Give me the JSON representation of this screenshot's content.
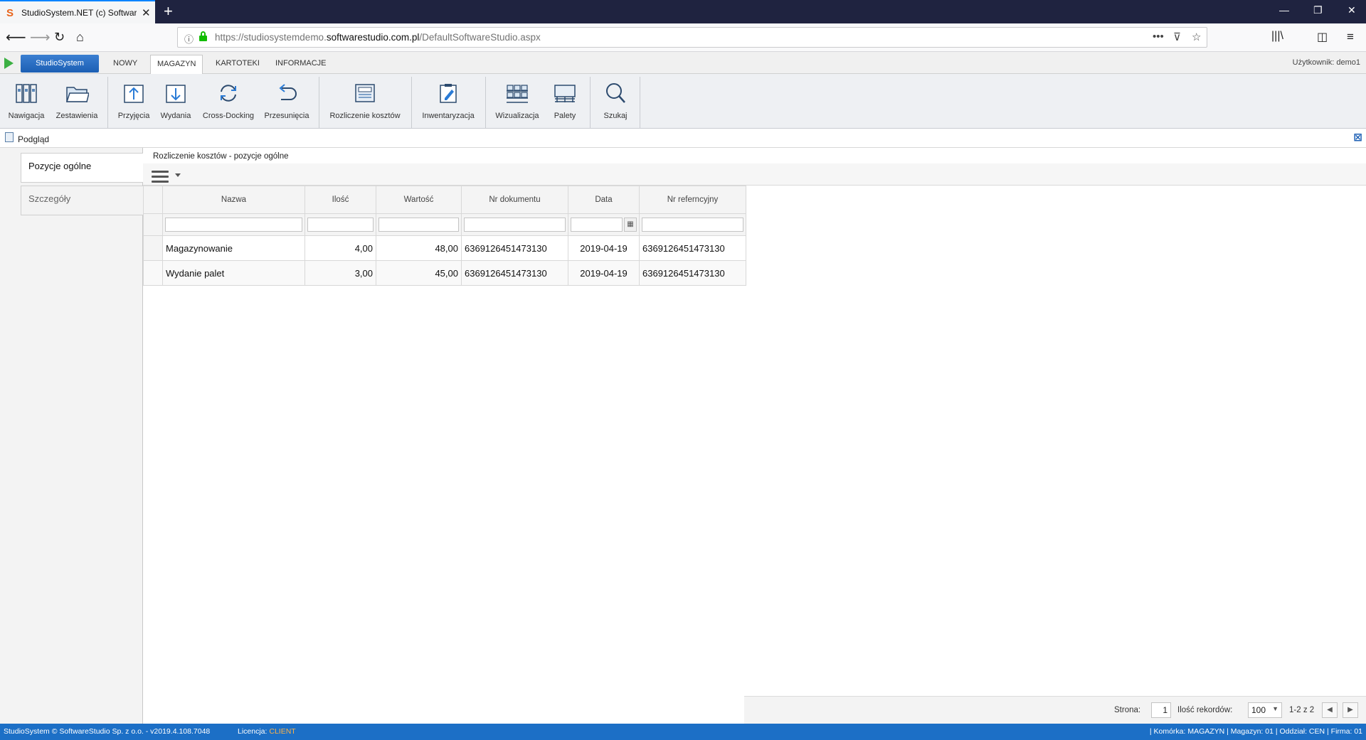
{
  "browser": {
    "tab_title": "StudioSystem.NET (c) SoftwareStudio",
    "url_plain": "https://studiosystemdemo.",
    "url_domain": "softwarestudio.com.pl",
    "url_path": "/DefaultSoftwareStudio.aspx"
  },
  "appmenu": {
    "brand": "StudioSystem",
    "tabs": [
      "NOWY",
      "MAGAZYN",
      "KARTOTEKI",
      "INFORMACJE"
    ],
    "active_tab": "MAGAZYN",
    "user": "Użytkownik: demo1"
  },
  "ribbon": {
    "items": [
      {
        "label": "Nawigacja",
        "icon": "binders-icon"
      },
      {
        "label": "Zestawienia",
        "icon": "folder-icon"
      },
      {
        "label": "Przyjęcia",
        "icon": "inbound-icon"
      },
      {
        "label": "Wydania",
        "icon": "outbound-icon"
      },
      {
        "label": "Cross-Docking",
        "icon": "refresh-icon"
      },
      {
        "label": "Przesunięcia",
        "icon": "undo-arrow-icon"
      },
      {
        "label": "Rozliczenie kosztów",
        "icon": "invoice-icon"
      },
      {
        "label": "Inwentaryzacja",
        "icon": "clipboard-icon"
      },
      {
        "label": "Wizualizacja",
        "icon": "shelves-icon"
      },
      {
        "label": "Palety",
        "icon": "pallet-icon"
      },
      {
        "label": "Szukaj",
        "icon": "search-icon"
      }
    ]
  },
  "preview": {
    "label": "Podgląd"
  },
  "left_tabs": [
    {
      "label": "Pozycje ogólne",
      "active": true
    },
    {
      "label": "Szczegóły",
      "active": false
    }
  ],
  "grid": {
    "title": "Rozliczenie kosztów - pozycje ogólne",
    "columns": [
      "Nazwa",
      "Ilość",
      "Wartość",
      "Nr dokumentu",
      "Data",
      "Nr referncyjny"
    ],
    "rows": [
      {
        "nazwa": "Magazynowanie",
        "ilosc": "4,00",
        "wartosc": "48,00",
        "nr_dokumentu": "6369126451473130",
        "data": "2019-04-19",
        "nr_ref": "6369126451473130"
      },
      {
        "nazwa": "Wydanie palet",
        "ilosc": "3,00",
        "wartosc": "45,00",
        "nr_dokumentu": "6369126451473130",
        "data": "2019-04-19",
        "nr_ref": "6369126451473130"
      }
    ]
  },
  "pager": {
    "page_label": "Strona:",
    "page_value": "1",
    "records_label": "Ilość rekordów:",
    "records_value": "100",
    "range": "1-2 z 2"
  },
  "statusbar": {
    "left": "StudioSystem © SoftwareStudio Sp. z o.o. - v2019.4.108.7048",
    "license_label": "Licencja:",
    "license_value": "CLIENT",
    "right": "| Komórka: MAGAZYN | Magazyn: 01 | Oddział: CEN | Firma: 01"
  }
}
